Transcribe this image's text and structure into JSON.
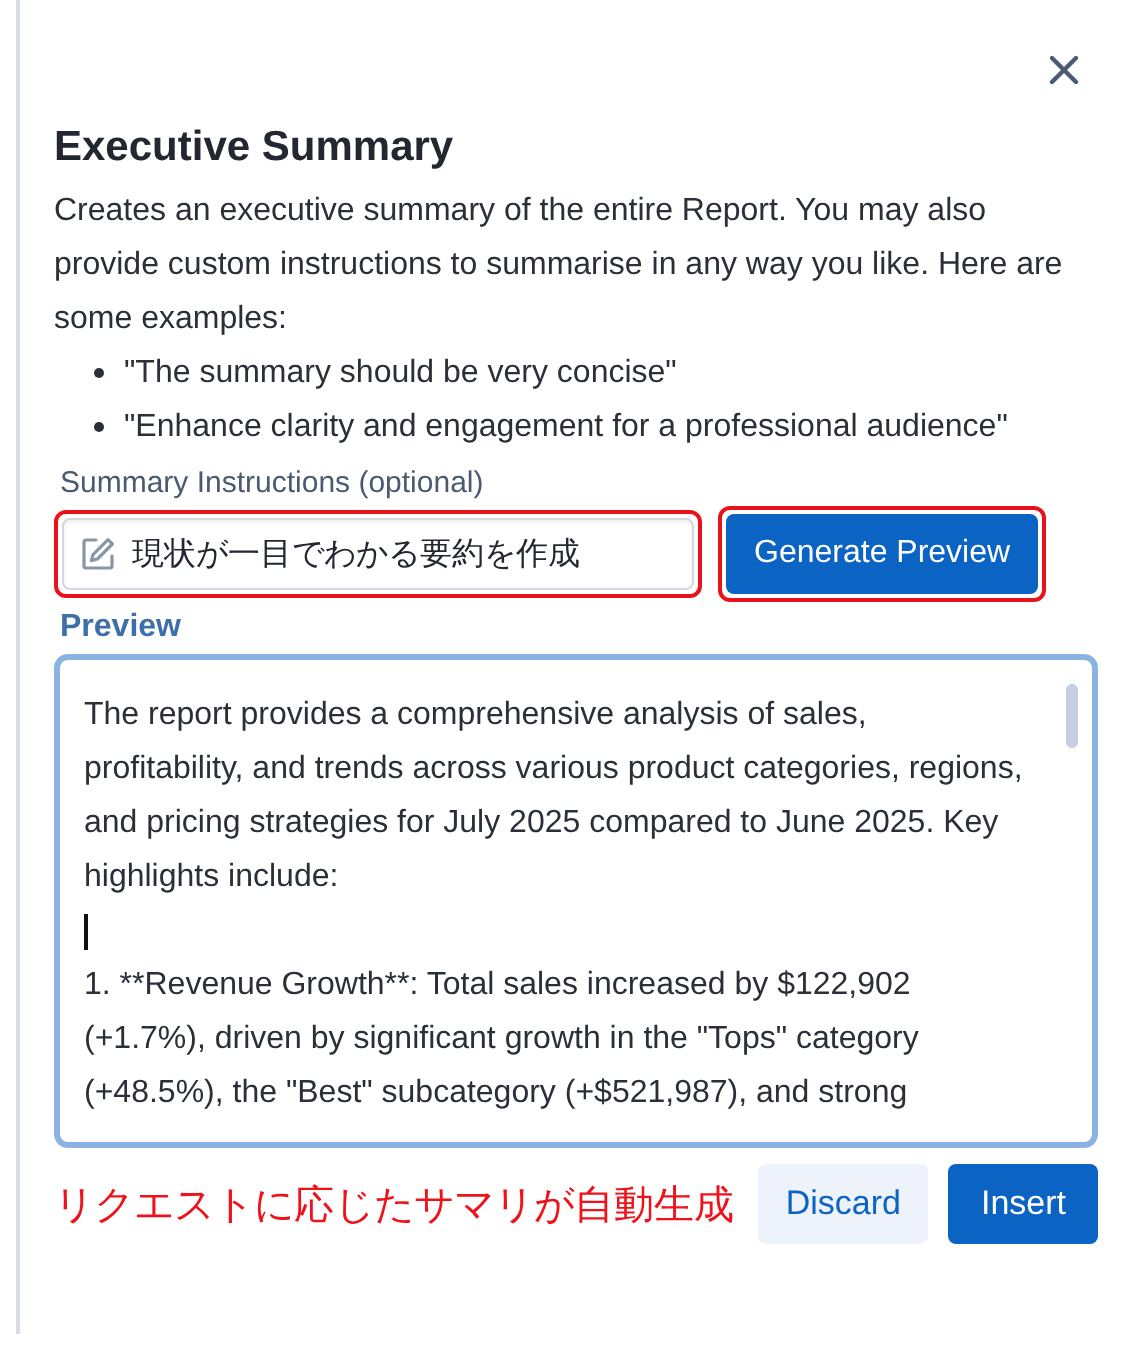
{
  "dialog": {
    "title": "Executive Summary",
    "description": "Creates an executive summary of the entire Report. You may also provide custom instructions to summarise in any way you like. Here are some examples:",
    "examples": [
      "\"The summary should be very concise\"",
      "\"Enhance clarity and engagement for a professional audience\""
    ],
    "instructions": {
      "label": "Summary Instructions (optional)",
      "value": "現状が一目でわかる要約を作成"
    },
    "generate_button": "Generate Preview",
    "preview": {
      "label": "Preview",
      "paragraphs": [
        "The report provides a comprehensive analysis of sales, profitability, and trends across various product categories, regions, and pricing strategies for July 2025 compared to June 2025. Key highlights include:",
        "1. **Revenue Growth**: Total sales increased by $122,902 (+1.7%), driven by significant growth in the \"Tops\" category (+48.5%), the \"Best\" subcategory (+$521,987), and strong"
      ]
    },
    "buttons": [
      "Discard",
      "Insert"
    ]
  },
  "annotation": {
    "text": "リクエストに応じたサマリが自動生成"
  }
}
